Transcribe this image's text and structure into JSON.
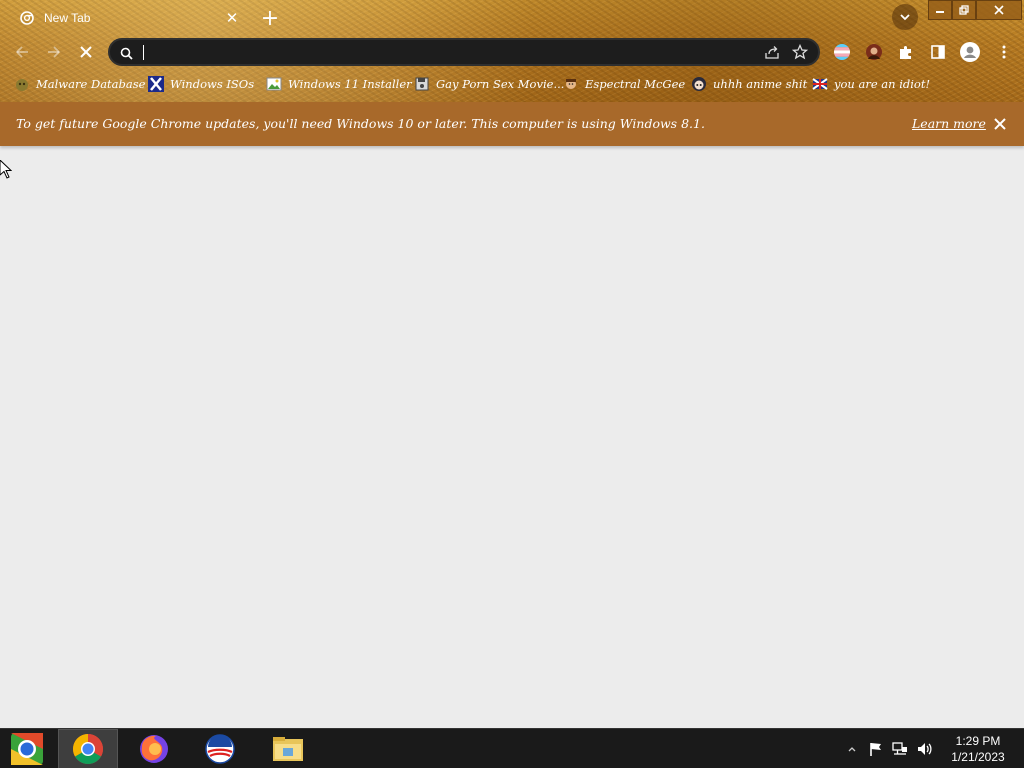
{
  "tab": {
    "title": "New Tab"
  },
  "omnibox": {
    "value": "",
    "placeholder": ""
  },
  "bookmarks": [
    {
      "label": "Malware Database",
      "icon": "malware-icon"
    },
    {
      "label": "Windows ISOs",
      "icon": "x-icon"
    },
    {
      "label": "Windows 11 Installer",
      "icon": "image-icon"
    },
    {
      "label": "Gay Porn Sex Movie...",
      "icon": "floppy-icon"
    },
    {
      "label": "Espectral McGee",
      "icon": "character-icon"
    },
    {
      "label": "uhhh anime shit",
      "icon": "anime-face-icon"
    },
    {
      "label": "you are an idiot!",
      "icon": "flag-icon"
    }
  ],
  "infobar": {
    "message": "To get future Google Chrome updates, you'll need Windows 10 or later. This computer is using Windows 8.1.",
    "link": "Learn more"
  },
  "clock": {
    "time": "1:29 PM",
    "date": "1/21/2023"
  },
  "colors": {
    "infobar": "#a8692a",
    "theme": "#b67a22",
    "taskbar": "#1a1a1a",
    "page": "#ececec"
  }
}
